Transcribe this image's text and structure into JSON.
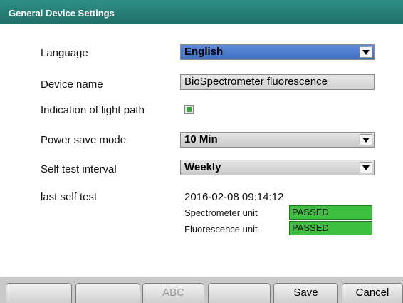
{
  "window": {
    "title": "General Device Settings"
  },
  "settings": {
    "language": {
      "label": "Language",
      "value": "English"
    },
    "device_name": {
      "label": "Device name",
      "value": "BioSpectrometer fluorescence"
    },
    "light_path": {
      "label": "Indication of light path",
      "checked": true
    },
    "power_save": {
      "label": "Power save mode",
      "value": "10 Min"
    },
    "self_test_interval": {
      "label": "Self test interval",
      "value": "Weekly"
    },
    "last_self_test": {
      "label": "last self test",
      "timestamp": "2016-02-08 09:14:12",
      "units": [
        {
          "name": "Spectrometer unit",
          "status": "PASSED"
        },
        {
          "name": "Fluorescence unit",
          "status": "PASSED"
        }
      ]
    }
  },
  "footer": {
    "buttons": [
      "",
      "",
      "ABC",
      "",
      "Save",
      "Cancel"
    ]
  },
  "colors": {
    "title_bar": "#1f7068",
    "selected_dropdown": "#3e6fc6",
    "passed": "#3fbf3f"
  }
}
